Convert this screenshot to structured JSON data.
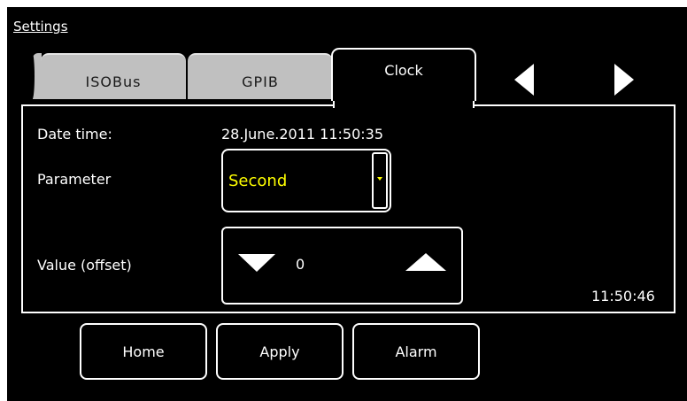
{
  "header": {
    "title": "Settings"
  },
  "tabs": [
    {
      "label": "ISOBus",
      "active": false
    },
    {
      "label": "GPIB",
      "active": false
    },
    {
      "label": "Clock",
      "active": true
    }
  ],
  "nav": {
    "prev_icon": "triangle-left-icon",
    "next_icon": "triangle-right-icon"
  },
  "clock_panel": {
    "date_time_label": "Date time:",
    "date_time_value": "28.June.2011 11:50:35",
    "parameter_label": "Parameter",
    "parameter_value": "Second",
    "value_label": "Value (offset)",
    "offset_value": "0",
    "clock_readout": "11:50:46"
  },
  "buttons": {
    "home": "Home",
    "apply": "Apply",
    "alarm": "Alarm"
  },
  "colors": {
    "background": "#000000",
    "foreground": "#ffffff",
    "inactive_tab": "#c0c0c0",
    "highlight": "#ffff00"
  }
}
